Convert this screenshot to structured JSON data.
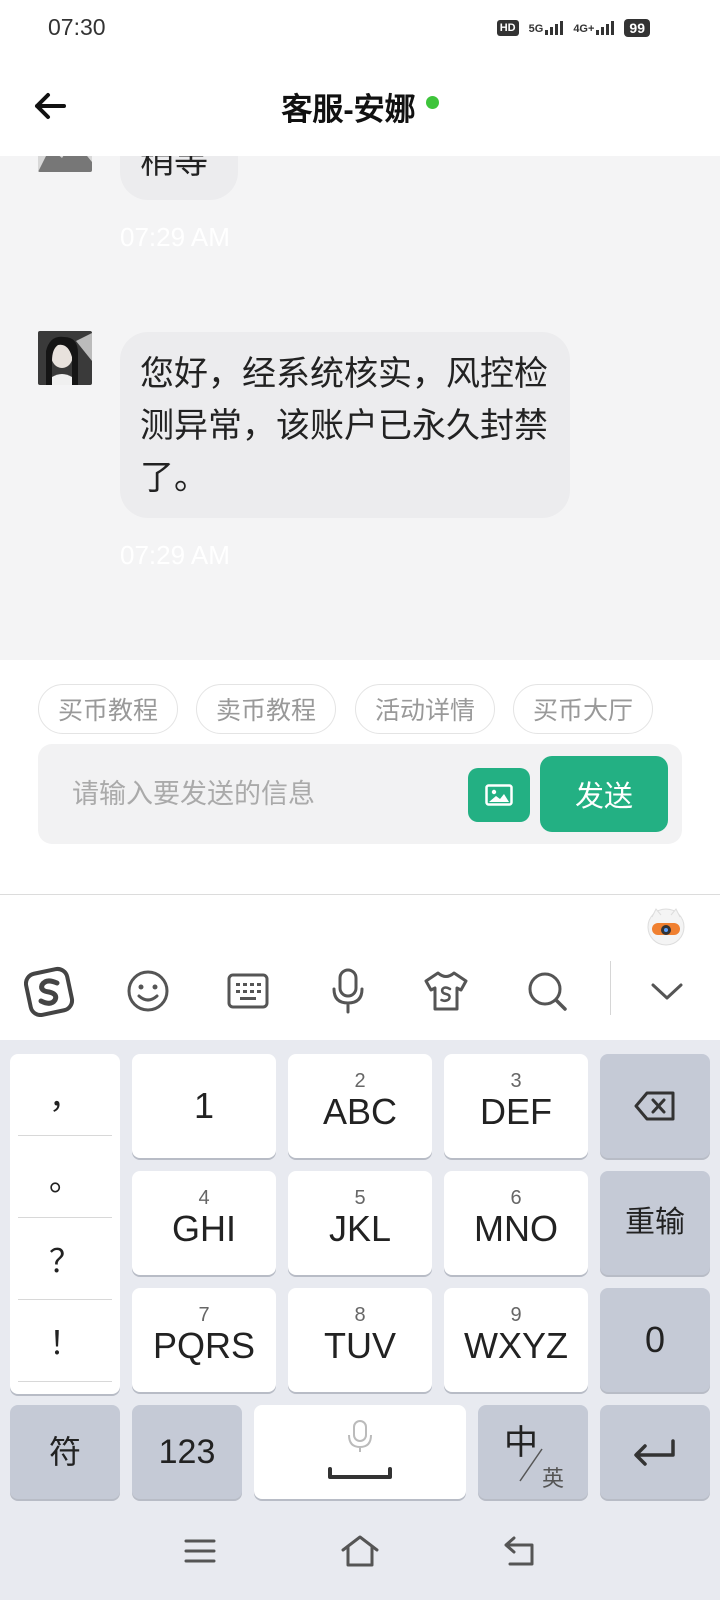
{
  "status": {
    "time": "07:30",
    "hd_label": "HD",
    "sim1_label": "5G",
    "sim2_label": "4G+",
    "battery": "99"
  },
  "header": {
    "title": "客服-安娜"
  },
  "messages": [
    {
      "text": "稍等",
      "time": "07:29 AM"
    },
    {
      "text": "您好，经系统核实，风控检测异常，该账户已永久封禁了。",
      "time": "07:29 AM"
    }
  ],
  "quick_tags": [
    "买币教程",
    "卖币教程",
    "活动详情",
    "买币大厅"
  ],
  "input": {
    "placeholder": "请输入要发送的信息",
    "send_label": "发送"
  },
  "keyboard": {
    "punctuation": [
      "，",
      "。",
      "？",
      "！"
    ],
    "keys": [
      {
        "num": "",
        "letters": "1"
      },
      {
        "num": "2",
        "letters": "ABC"
      },
      {
        "num": "3",
        "letters": "DEF"
      },
      {
        "num": "4",
        "letters": "GHI"
      },
      {
        "num": "5",
        "letters": "JKL"
      },
      {
        "num": "6",
        "letters": "MNO"
      },
      {
        "num": "7",
        "letters": "PQRS"
      },
      {
        "num": "8",
        "letters": "TUV"
      },
      {
        "num": "9",
        "letters": "WXYZ"
      }
    ],
    "reenter_label": "重输",
    "zero_label": "0",
    "symbol_label": "符",
    "num_label": "123",
    "lang_main": "中",
    "lang_sub": "英"
  },
  "colors": {
    "accent": "#23b083",
    "online": "#3ec43b"
  }
}
